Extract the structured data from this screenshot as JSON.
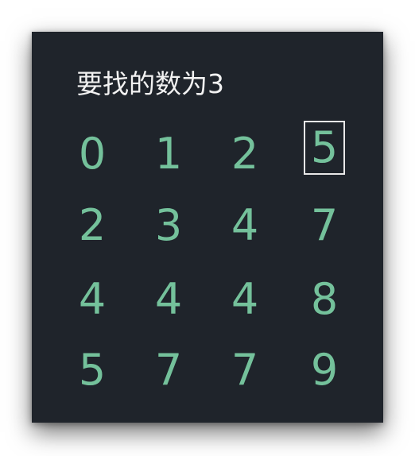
{
  "title": "要找的数为3",
  "highlight_color": "#e8e8e8",
  "digit_color": "#74c19b",
  "background_color": "#1f242b",
  "matrix": [
    [
      "0",
      "1",
      "2",
      "5"
    ],
    [
      "2",
      "3",
      "4",
      "7"
    ],
    [
      "4",
      "4",
      "4",
      "8"
    ],
    [
      "5",
      "7",
      "7",
      "9"
    ]
  ],
  "highlighted_cell": {
    "row": 0,
    "col": 3
  }
}
